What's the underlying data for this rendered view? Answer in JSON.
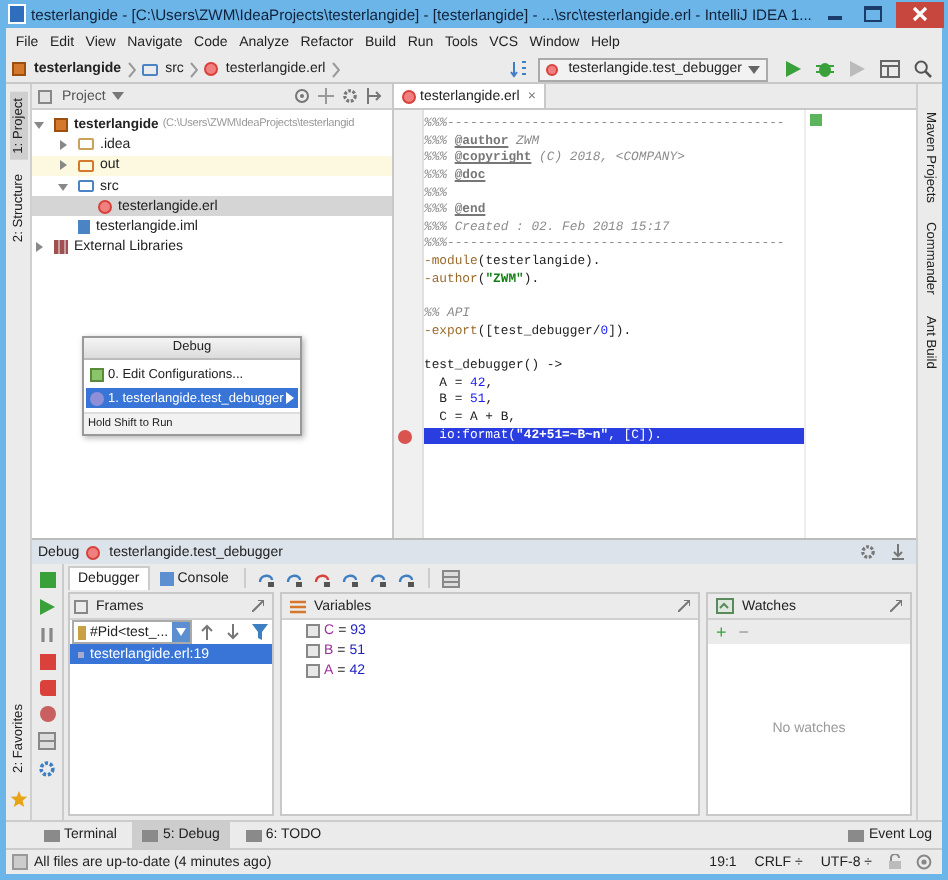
{
  "window": {
    "title": "testerlangide - [C:\\Users\\ZWM\\IdeaProjects\\testerlangide] - [testerlangide] - ...\\src\\testerlangide.erl - IntelliJ IDEA 1..."
  },
  "menu": [
    "File",
    "Edit",
    "View",
    "Navigate",
    "Code",
    "Analyze",
    "Refactor",
    "Build",
    "Run",
    "Tools",
    "VCS",
    "Window",
    "Help"
  ],
  "breadcrumbs": [
    {
      "label": "testerlangide",
      "kind": "project"
    },
    {
      "label": "src",
      "kind": "folder"
    },
    {
      "label": "testerlangide.erl",
      "kind": "file"
    }
  ],
  "run_config": "testerlangide.test_debugger",
  "left_tool_tabs": [
    {
      "label": "1: Project",
      "selected": true
    },
    {
      "label": "2: Structure",
      "selected": false
    }
  ],
  "left_bottom_tab": "2: Favorites",
  "right_tool_tabs": [
    "Maven Projects",
    "Commander",
    "Ant Build"
  ],
  "project": {
    "title": "Project",
    "tree": [
      {
        "label": "testerlangide",
        "path": "(C:\\Users\\ZWM\\IdeaProjects\\testerlangid",
        "kind": "project",
        "expanded": true,
        "selected": false,
        "children": [
          {
            "label": ".idea",
            "kind": "folder",
            "expanded": false,
            "selected": false
          },
          {
            "label": "out",
            "kind": "excluded",
            "expanded": false,
            "selected": false
          },
          {
            "label": "src",
            "kind": "source",
            "expanded": true,
            "selected": false,
            "children": [
              {
                "label": "testerlangide.erl",
                "kind": "erl",
                "selected": true
              }
            ]
          },
          {
            "label": "testerlangide.iml",
            "kind": "iml",
            "selected": false
          }
        ]
      },
      {
        "label": "External Libraries",
        "kind": "library",
        "expanded": false,
        "selected": false
      }
    ]
  },
  "popup": {
    "title": "Debug",
    "items": [
      {
        "label": "0. Edit Configurations...",
        "kind": "edit",
        "selected": false
      },
      {
        "label": "1. testerlangide.test_debugger",
        "kind": "config",
        "selected": true
      }
    ],
    "footer": "Hold Shift to Run"
  },
  "editor": {
    "tab": "testerlangide.erl",
    "close": "×",
    "lines": [
      {
        "kind": "code",
        "current": false,
        "breakpoint": false,
        "segments": [
          {
            "kind": "comment",
            "text": "%%%--------------------------------------------"
          }
        ]
      },
      {
        "kind": "code",
        "current": false,
        "breakpoint": false,
        "segments": [
          {
            "kind": "comment",
            "text": "%%% "
          },
          {
            "kind": "tag",
            "text": "@author"
          },
          {
            "kind": "comment",
            "text": " ZWM"
          }
        ]
      },
      {
        "kind": "code",
        "current": false,
        "breakpoint": false,
        "segments": [
          {
            "kind": "comment",
            "text": "%%% "
          },
          {
            "kind": "tag",
            "text": "@copyright"
          },
          {
            "kind": "comment",
            "text": " (C) 2018, <COMPANY>"
          }
        ]
      },
      {
        "kind": "code",
        "current": false,
        "breakpoint": false,
        "segments": [
          {
            "kind": "comment",
            "text": "%%% "
          },
          {
            "kind": "tag",
            "text": "@doc"
          }
        ]
      },
      {
        "kind": "code",
        "current": false,
        "breakpoint": false,
        "segments": [
          {
            "kind": "comment",
            "text": "%%%"
          }
        ]
      },
      {
        "kind": "code",
        "current": false,
        "breakpoint": false,
        "segments": [
          {
            "kind": "comment",
            "text": "%%% "
          },
          {
            "kind": "tag",
            "text": "@end"
          }
        ]
      },
      {
        "kind": "code",
        "current": false,
        "breakpoint": false,
        "segments": [
          {
            "kind": "comment",
            "text": "%%% Created : 02. Feb 2018 15:17"
          }
        ]
      },
      {
        "kind": "code",
        "current": false,
        "breakpoint": false,
        "segments": [
          {
            "kind": "comment",
            "text": "%%%--------------------------------------------"
          }
        ]
      },
      {
        "kind": "code",
        "current": false,
        "breakpoint": false,
        "segments": [
          {
            "kind": "attr",
            "text": "-module"
          },
          {
            "kind": "plain",
            "text": "(testerlangide)."
          }
        ]
      },
      {
        "kind": "code",
        "current": false,
        "breakpoint": false,
        "segments": [
          {
            "kind": "attr",
            "text": "-author"
          },
          {
            "kind": "plain",
            "text": "("
          },
          {
            "kind": "string",
            "text": "\"ZWM\""
          },
          {
            "kind": "plain",
            "text": ")."
          }
        ]
      },
      {
        "kind": "blank"
      },
      {
        "kind": "code",
        "current": false,
        "breakpoint": false,
        "segments": [
          {
            "kind": "comment",
            "text": "%% API"
          }
        ]
      },
      {
        "kind": "code",
        "current": false,
        "breakpoint": false,
        "segments": [
          {
            "kind": "attr",
            "text": "-export"
          },
          {
            "kind": "plain",
            "text": "([test_debugger/"
          },
          {
            "kind": "number",
            "text": "0"
          },
          {
            "kind": "plain",
            "text": "])."
          }
        ]
      },
      {
        "kind": "blank"
      },
      {
        "kind": "code",
        "current": false,
        "breakpoint": false,
        "segments": [
          {
            "kind": "plain",
            "text": "test_debugger() ->"
          }
        ]
      },
      {
        "kind": "code",
        "current": false,
        "breakpoint": false,
        "segments": [
          {
            "kind": "plain",
            "text": "  A = "
          },
          {
            "kind": "number",
            "text": "42"
          },
          {
            "kind": "plain",
            "text": ","
          }
        ]
      },
      {
        "kind": "code",
        "current": false,
        "breakpoint": false,
        "segments": [
          {
            "kind": "plain",
            "text": "  B = "
          },
          {
            "kind": "number",
            "text": "51"
          },
          {
            "kind": "plain",
            "text": ","
          }
        ]
      },
      {
        "kind": "code",
        "current": false,
        "breakpoint": false,
        "segments": [
          {
            "kind": "plain",
            "text": "  C = A + B,"
          }
        ]
      },
      {
        "kind": "code",
        "current": true,
        "breakpoint": true,
        "segments": [
          {
            "kind": "plain",
            "text": "  io:format("
          },
          {
            "kind": "string",
            "text": "\"42+51=~B~n\""
          },
          {
            "kind": "plain",
            "text": ", [C])."
          }
        ]
      }
    ]
  },
  "debug": {
    "title": "Debug",
    "config": "testerlangide.test_debugger",
    "tabs": [
      {
        "label": "Debugger",
        "selected": true
      },
      {
        "label": "Console",
        "selected": false
      }
    ],
    "frames": {
      "title": "Frames",
      "thread": "#Pid<test_...",
      "items": [
        {
          "label": "testerlangide.erl:19",
          "selected": true
        }
      ]
    },
    "variables": {
      "title": "Variables",
      "items": [
        {
          "name": "C",
          "operator": "=",
          "value": "93"
        },
        {
          "name": "B",
          "operator": "=",
          "value": "51"
        },
        {
          "name": "A",
          "operator": "=",
          "value": "42"
        }
      ]
    },
    "watches": {
      "title": "Watches",
      "add": "+",
      "remove": "−",
      "empty": "No watches"
    }
  },
  "tool_tabs": [
    {
      "label": "Terminal",
      "selected": false
    },
    {
      "label": "5: Debug",
      "selected": true
    },
    {
      "label": "6: TODO",
      "selected": false
    }
  ],
  "event_log": "Event Log",
  "status_bar": {
    "message": "All files are up-to-date (4 minutes ago)",
    "position": "19:1",
    "line_separator": "CRLF ÷",
    "encoding": "UTF-8 ÷"
  }
}
